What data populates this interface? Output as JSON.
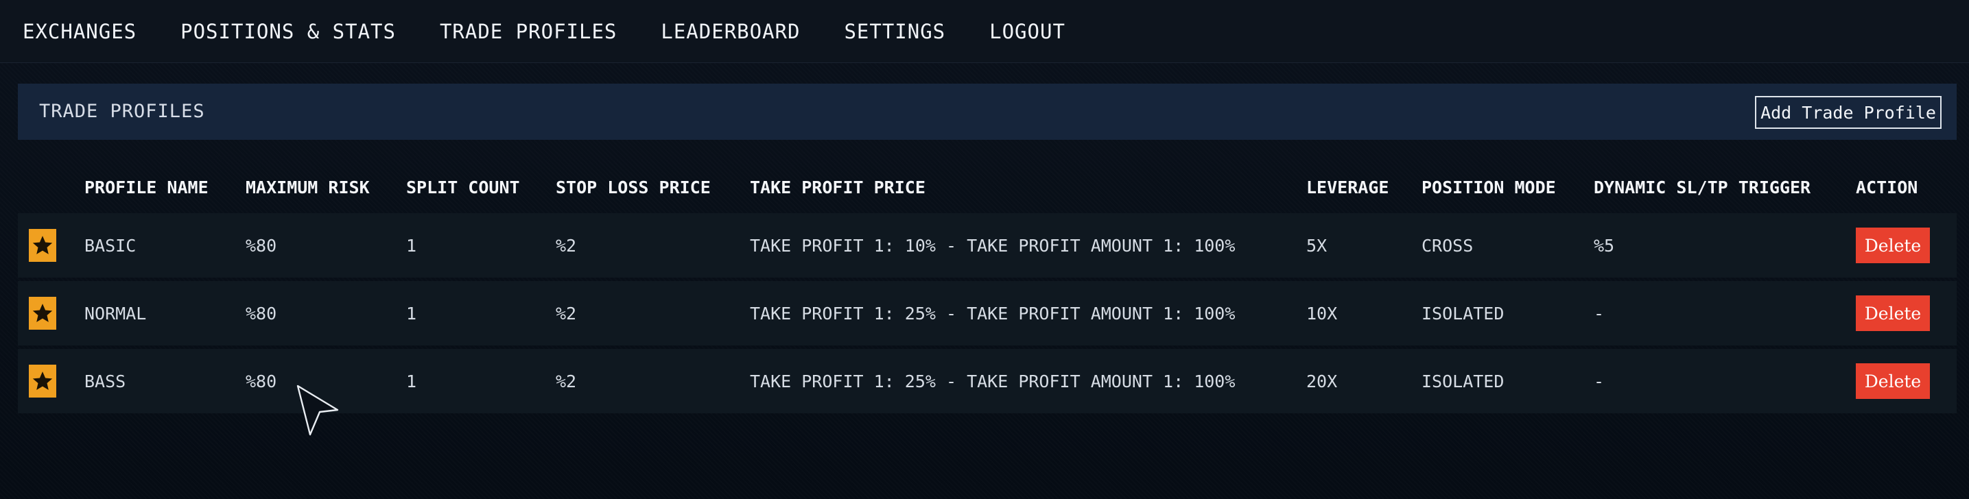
{
  "nav": {
    "items": [
      {
        "label": "EXCHANGES"
      },
      {
        "label": "POSITIONS & STATS"
      },
      {
        "label": "TRADE PROFILES"
      },
      {
        "label": "LEADERBOARD"
      },
      {
        "label": "SETTINGS"
      },
      {
        "label": "LOGOUT"
      }
    ]
  },
  "panel": {
    "title": "TRADE PROFILES",
    "add_button_label": "Add Trade Profile"
  },
  "table": {
    "columns": [
      "PROFILE NAME",
      "MAXIMUM RISK",
      "SPLIT COUNT",
      "STOP LOSS PRICE",
      "TAKE PROFIT PRICE",
      "LEVERAGE",
      "POSITION MODE",
      "DYNAMIC SL/TP TRIGGER",
      "ACTION"
    ],
    "rows": [
      {
        "icon": "star-icon",
        "name": "BASIC",
        "max_risk": "%80",
        "split_count": "1",
        "stop_loss": "%2",
        "take_profit": "TAKE PROFIT 1: 10% - TAKE PROFIT AMOUNT 1: 100%",
        "leverage": "5X",
        "position_mode": "CROSS",
        "dynamic_trigger": "%5",
        "action_label": "Delete"
      },
      {
        "icon": "star-icon",
        "name": "NORMAL",
        "max_risk": "%80",
        "split_count": "1",
        "stop_loss": "%2",
        "take_profit": "TAKE PROFIT 1: 25% - TAKE PROFIT AMOUNT 1: 100%",
        "leverage": "10X",
        "position_mode": "ISOLATED",
        "dynamic_trigger": "-",
        "action_label": "Delete"
      },
      {
        "icon": "star-icon",
        "name": "BASS",
        "max_risk": "%80",
        "split_count": "1",
        "stop_loss": "%2",
        "take_profit": "TAKE PROFIT 1: 25% - TAKE PROFIT AMOUNT 1: 100%",
        "leverage": "20X",
        "position_mode": "ISOLATED",
        "dynamic_trigger": "-",
        "action_label": "Delete"
      }
    ]
  },
  "colors": {
    "background": "#070d15",
    "nav_background": "#0d141d",
    "panel_header": "#16253b",
    "row_background": "#0f1820",
    "star_badge": "#f0a020",
    "delete_button": "#e8402e"
  }
}
